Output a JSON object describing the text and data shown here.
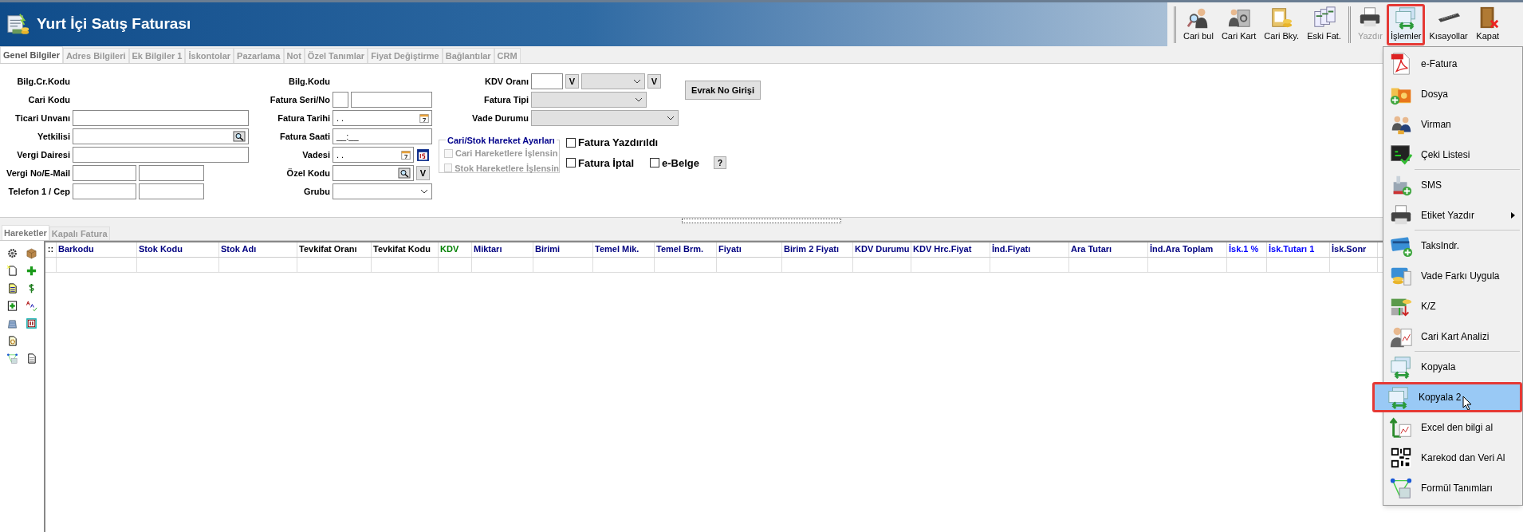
{
  "window": {
    "title": "Yurt İçi Satış Faturası"
  },
  "toolbar": {
    "groups": [
      [
        {
          "label": "Cari bul",
          "disabled": false,
          "selected": false
        },
        {
          "label": "Cari Kart",
          "disabled": false,
          "selected": false
        },
        {
          "label": "Cari Bky.",
          "disabled": false,
          "selected": false
        },
        {
          "label": "Eski Fat.",
          "disabled": false,
          "selected": false
        }
      ],
      [
        {
          "label": "Yazdır",
          "disabled": true,
          "selected": false
        },
        {
          "label": "İşlemler",
          "disabled": false,
          "selected": true
        },
        {
          "label": "Kısayollar",
          "disabled": false,
          "selected": false
        },
        {
          "label": "Kapat",
          "disabled": false,
          "selected": false
        }
      ]
    ]
  },
  "tabs": [
    {
      "label": "Genel Bilgiler",
      "selected": true
    },
    {
      "label": "Adres Bilgileri",
      "selected": false
    },
    {
      "label": "Ek Bilgiler 1",
      "selected": false
    },
    {
      "label": "İskontolar",
      "selected": false
    },
    {
      "label": "Pazarlama",
      "selected": false
    },
    {
      "label": "Not",
      "selected": false
    },
    {
      "label": "Özel Tanımlar",
      "selected": false
    },
    {
      "label": "Fiyat Değiştirme",
      "selected": false
    },
    {
      "label": "Bağlantılar",
      "selected": false
    },
    {
      "label": "CRM",
      "selected": false
    }
  ],
  "form": {
    "column_1": [
      {
        "label": "Bilg.Cr.Kodu",
        "kind": "none"
      },
      {
        "label": "Cari Kodu",
        "kind": "none"
      },
      {
        "label": "Ticari Unvanı",
        "kind": "text"
      },
      {
        "label": "Yetkilisi",
        "kind": "lookup"
      },
      {
        "label": "Vergi Dairesi",
        "kind": "text"
      },
      {
        "label": "Vergi No/E-Mail",
        "kind": "double"
      },
      {
        "label": "Telefon 1 / Cep",
        "kind": "double"
      }
    ],
    "column_2": [
      {
        "label": "Bilg.Kodu",
        "kind": "none"
      },
      {
        "label": "Fatura Seri/No",
        "kind": "serial"
      },
      {
        "label": "Fatura Tarihi",
        "kind": "date",
        "value": ". ."
      },
      {
        "label": "Fatura Saati",
        "kind": "text",
        "value": "__:__"
      },
      {
        "label": "Vadesi",
        "kind": "date_calendar",
        "value": ". ."
      },
      {
        "label": "Özel Kodu",
        "kind": "lookup_v",
        "button": "V"
      },
      {
        "label": "Grubu",
        "kind": "select"
      }
    ],
    "column_3": [
      {
        "label": "KDV Oranı",
        "kind": "kdv",
        "button": "V",
        "button_2": "V"
      },
      {
        "label": "Fatura Tipi",
        "kind": "select"
      },
      {
        "label": "Vade Durumu",
        "kind": "select_wide"
      }
    ],
    "evrak_button": "Evrak No Girişi",
    "group": {
      "title": "Cari/Stok Hareket Ayarları",
      "options": [
        {
          "label": "Cari Hareketlere İşlensin",
          "checked": false,
          "disabled": true
        },
        {
          "label": "Stok Hareketlere İşlensin",
          "checked": false,
          "disabled": true
        }
      ]
    },
    "checks": [
      {
        "label": "Fatura Yazdırıldı",
        "checked": false
      },
      {
        "label": "Fatura İptal",
        "checked": false
      },
      {
        "label": "e-Belge",
        "checked": false
      }
    ],
    "help_button": "?"
  },
  "lower_tabs": [
    {
      "label": "Hareketler",
      "selected": true
    },
    {
      "label": "Kapalı Fatura",
      "selected": false
    }
  ],
  "grid": {
    "marker": "::",
    "columns": [
      {
        "label": "Barkodu",
        "color": "#000080"
      },
      {
        "label": "Stok Kodu",
        "color": "#000080"
      },
      {
        "label": "Stok Adı",
        "color": "#000080"
      },
      {
        "label": "Tevkifat Oranı",
        "color": "#000000"
      },
      {
        "label": "Tevkifat Kodu",
        "color": "#000000"
      },
      {
        "label": "KDV",
        "color": "#008000"
      },
      {
        "label": "Miktarı",
        "color": "#000080"
      },
      {
        "label": "Birimi",
        "color": "#000080"
      },
      {
        "label": "Temel Mik.",
        "color": "#000080"
      },
      {
        "label": "Temel Brm.",
        "color": "#000080"
      },
      {
        "label": "Fiyatı",
        "color": "#000080"
      },
      {
        "label": "Birim 2 Fiyatı",
        "color": "#000080"
      },
      {
        "label": "KDV Durumu",
        "color": "#000080"
      },
      {
        "label": "KDV Hrc.Fiyat",
        "color": "#000080"
      },
      {
        "label": "İnd.Fiyatı",
        "color": "#000080"
      },
      {
        "label": "Ara Tutarı",
        "color": "#000080"
      },
      {
        "label": "İnd.Ara Toplam",
        "color": "#000080"
      },
      {
        "label": "İsk.1 %",
        "color": "#0000ff"
      },
      {
        "label": "İsk.Tutarı 1",
        "color": "#0000ff"
      },
      {
        "label": "İsk.Sonr",
        "color": "#000080"
      }
    ]
  },
  "menu": {
    "items": [
      {
        "label": "e-Fatura",
        "selected": false
      },
      {
        "label": "Dosya",
        "selected": false
      },
      {
        "label": "Virman",
        "selected": false
      },
      {
        "label": "Çeki Listesi",
        "selected": false,
        "separator_after": true
      },
      {
        "label": "SMS",
        "selected": false
      },
      {
        "label": "Etiket Yazdır",
        "selected": false,
        "submenu": true,
        "separator_after": true
      },
      {
        "label": "TaksIndr.",
        "selected": false
      },
      {
        "label": "Vade Farkı Uygula",
        "selected": false
      },
      {
        "label": "K/Z",
        "selected": false
      },
      {
        "label": "Cari Kart Analizi",
        "selected": false,
        "separator_after": true
      },
      {
        "label": "Kopyala",
        "selected": false
      },
      {
        "label": "Kopyala 2",
        "selected": true
      },
      {
        "label": "Excel den bilgi al",
        "selected": false
      },
      {
        "label": "Karekod dan Veri Al",
        "selected": false
      },
      {
        "label": "Formül Tanımları",
        "selected": false
      }
    ]
  }
}
